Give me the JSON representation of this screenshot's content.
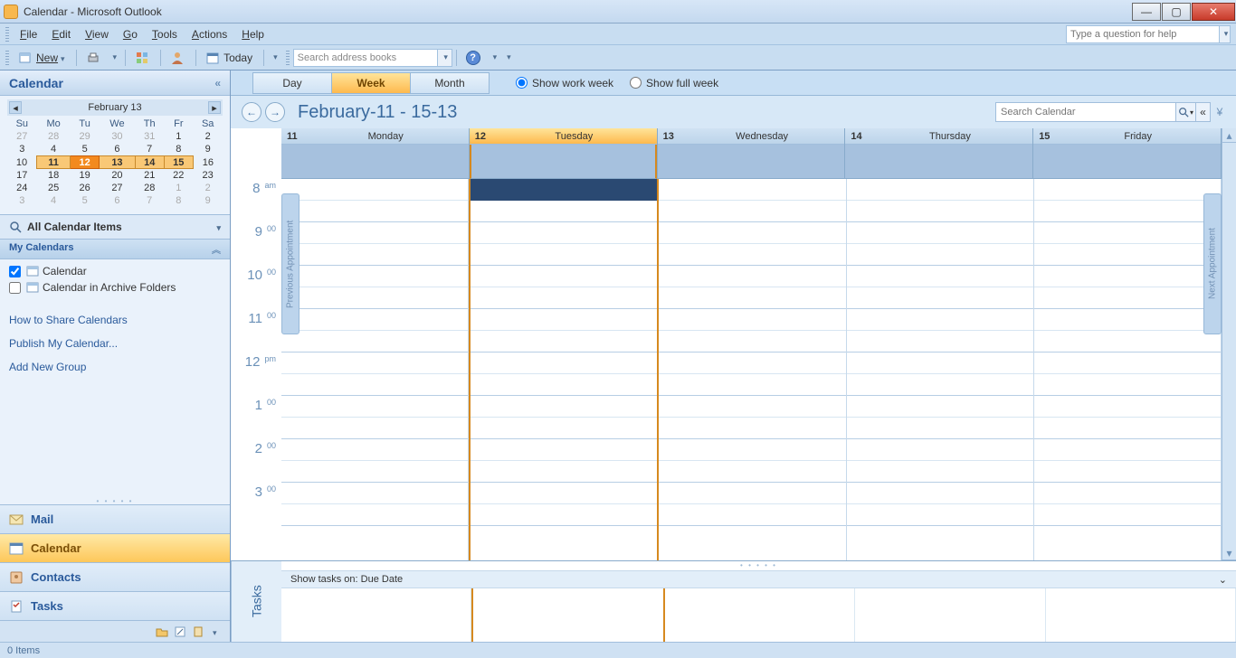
{
  "window": {
    "title": "Calendar - Microsoft Outlook"
  },
  "menu": {
    "items": [
      "File",
      "Edit",
      "View",
      "Go",
      "Tools",
      "Actions",
      "Help"
    ],
    "help_placeholder": "Type a question for help"
  },
  "toolbar": {
    "new": "New",
    "today": "Today",
    "address_placeholder": "Search address books"
  },
  "sidebar": {
    "title": "Calendar",
    "minical_month": "February 13",
    "dow": [
      "Su",
      "Mo",
      "Tu",
      "We",
      "Th",
      "Fr",
      "Sa"
    ],
    "weeks": [
      [
        {
          "d": 27,
          "o": 1
        },
        {
          "d": 28,
          "o": 1
        },
        {
          "d": 29,
          "o": 1
        },
        {
          "d": 30,
          "o": 1
        },
        {
          "d": 31,
          "o": 1
        },
        {
          "d": 1
        },
        {
          "d": 2
        }
      ],
      [
        {
          "d": 3
        },
        {
          "d": 4
        },
        {
          "d": 5
        },
        {
          "d": 6
        },
        {
          "d": 7
        },
        {
          "d": 8
        },
        {
          "d": 9
        }
      ],
      [
        {
          "d": 10
        },
        {
          "d": 11,
          "s": 1
        },
        {
          "d": 12,
          "t": 1
        },
        {
          "d": 13,
          "s": 1
        },
        {
          "d": 14,
          "s": 1
        },
        {
          "d": 15,
          "s": 1
        },
        {
          "d": 16
        }
      ],
      [
        {
          "d": 17
        },
        {
          "d": 18
        },
        {
          "d": 19
        },
        {
          "d": 20
        },
        {
          "d": 21
        },
        {
          "d": 22
        },
        {
          "d": 23
        }
      ],
      [
        {
          "d": 24
        },
        {
          "d": 25
        },
        {
          "d": 26
        },
        {
          "d": 27
        },
        {
          "d": 28
        },
        {
          "d": 1,
          "o": 1
        },
        {
          "d": 2,
          "o": 1
        }
      ],
      [
        {
          "d": 3,
          "o": 1
        },
        {
          "d": 4,
          "o": 1
        },
        {
          "d": 5,
          "o": 1
        },
        {
          "d": 6,
          "o": 1
        },
        {
          "d": 7,
          "o": 1
        },
        {
          "d": 8,
          "o": 1
        },
        {
          "d": 9,
          "o": 1
        }
      ]
    ],
    "all_items": "All Calendar Items",
    "my_calendars": "My Calendars",
    "cal_list": [
      {
        "label": "Calendar",
        "checked": true
      },
      {
        "label": "Calendar in Archive Folders",
        "checked": false
      }
    ],
    "links": [
      "How to Share Calendars",
      "Publish My Calendar...",
      "Add New Group"
    ],
    "nav": [
      {
        "label": "Mail",
        "icon": "mail",
        "active": false
      },
      {
        "label": "Calendar",
        "icon": "calendar",
        "active": true
      },
      {
        "label": "Contacts",
        "icon": "contacts",
        "active": false
      },
      {
        "label": "Tasks",
        "icon": "tasks",
        "active": false
      }
    ]
  },
  "view": {
    "tabs": [
      {
        "label": "Day"
      },
      {
        "label": "Week"
      },
      {
        "label": "Month"
      }
    ],
    "active_tab": 1,
    "show_work_week": "Show work week",
    "show_full_week": "Show full week",
    "selected_radio": 0,
    "range": "February-11 - 15-13",
    "search_placeholder": "Search Calendar",
    "prev_appt": "Previous Appointment",
    "next_appt": "Next Appointment"
  },
  "days": [
    {
      "num": "11",
      "name": "Monday",
      "today": false
    },
    {
      "num": "12",
      "name": "Tuesday",
      "today": true
    },
    {
      "num": "13",
      "name": "Wednesday",
      "today": false
    },
    {
      "num": "14",
      "name": "Thursday",
      "today": false
    },
    {
      "num": "15",
      "name": "Friday",
      "today": false
    }
  ],
  "hours": [
    {
      "h": "8",
      "m": "am"
    },
    {
      "h": "9",
      "m": "00"
    },
    {
      "h": "10",
      "m": "00"
    },
    {
      "h": "11",
      "m": "00"
    },
    {
      "h": "12",
      "m": "pm"
    },
    {
      "h": "1",
      "m": "00"
    },
    {
      "h": "2",
      "m": "00"
    },
    {
      "h": "3",
      "m": "00"
    }
  ],
  "tasks": {
    "label": "Tasks",
    "header": "Show tasks on: Due Date"
  },
  "status": {
    "items": "0 Items"
  }
}
